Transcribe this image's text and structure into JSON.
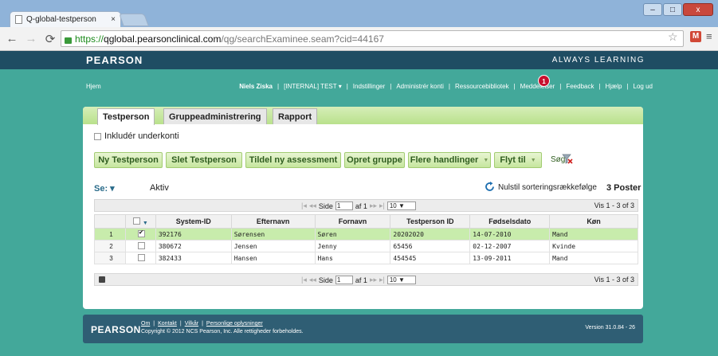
{
  "browser": {
    "tab_title": "Q-global-testperson",
    "tab_close": "×",
    "url_scheme": "https://",
    "url_host": "qglobal.pearsonclinical.com",
    "url_path": "/qg/searchExaminee.seam?cid=44167",
    "window_buttons": [
      "–",
      "□",
      "x"
    ]
  },
  "header": {
    "logo": "PEARSON",
    "tagline": "ALWAYS LEARNING"
  },
  "topnav": {
    "home": "Hjem",
    "user": "Niels Ziska",
    "items": [
      "[INTERNAL] TEST ▾",
      "Indstillinger",
      "Administrér konti",
      "Ressourcebibliotek",
      "Meddelelser",
      "Feedback",
      "Hjælp",
      "Log ud"
    ],
    "badge": "1",
    "sep": "|"
  },
  "tabs": [
    "Testperson",
    "Gruppeadministrering",
    "Rapport"
  ],
  "include_sub": "Inkludér underkonti",
  "actions": {
    "new": "Ny Testperson",
    "delete": "Slet Testperson",
    "assign": "Tildel ny assessment",
    "group": "Opret gruppe",
    "more": "Flere handlinger",
    "move": "Flyt til",
    "search": "Søg"
  },
  "filter": {
    "se_label": "Se: ▾",
    "status": "Aktiv",
    "reset_sort": "Nulstil sorteringsrækkefølge",
    "count": "3 Poster"
  },
  "pager": {
    "page_label": "Side",
    "page": "1",
    "of_label": "af 1",
    "per_page": "10 ▼",
    "range": "Vis 1 - 3 of 3"
  },
  "table": {
    "columns": [
      "System-ID",
      "Efternavn",
      "Fornavn",
      "Testperson ID",
      "Fødselsdato",
      "Køn"
    ],
    "rows": [
      {
        "n": "1",
        "checked": true,
        "system_id": "392176",
        "last": "Sørensen",
        "first": "Søren",
        "pid": "20202020",
        "dob": "14-07-2010",
        "sex": "Mand"
      },
      {
        "n": "2",
        "checked": false,
        "system_id": "380672",
        "last": "Jensen",
        "first": "Jenny",
        "pid": "65456",
        "dob": "02-12-2007",
        "sex": "Kvinde"
      },
      {
        "n": "3",
        "checked": false,
        "system_id": "382433",
        "last": "Hansen",
        "first": "Hans",
        "pid": "454545",
        "dob": "13-09-2011",
        "sex": "Mand"
      }
    ]
  },
  "footer": {
    "logo": "PEARSON",
    "links": [
      "Om",
      "Kontakt",
      "Vilkår",
      "Personlige oplysninger"
    ],
    "sep": "|",
    "copyright": "Copyright © 2012 NCS Pearson, Inc. Alle rettigheder forbeholdes.",
    "version": "Version 31.0.84 - 26"
  },
  "colors": {
    "teal_bg": "#43a89a",
    "header_bg": "#1f4d63",
    "selected_row": "#c8ecac",
    "button_green": "#c6e69e",
    "badge_red": "#c8102e"
  }
}
